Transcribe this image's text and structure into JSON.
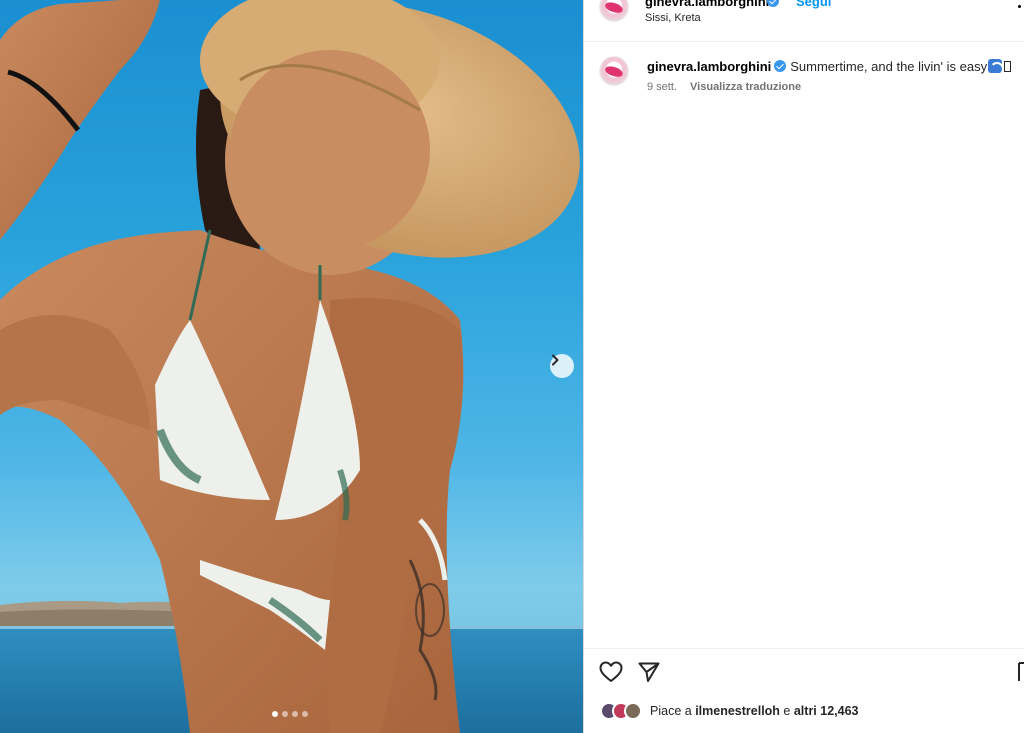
{
  "post": {
    "username": "ginevra.lamborghini",
    "follow_label": "Segui",
    "location": "Sissi, Kreta",
    "caption": "Summertime, and the livin' is easy",
    "date": "9 sett.",
    "translate_label": "Visualizza traduzione",
    "likes_prefix": "Piace a",
    "likes_user": "ilmenestrelloh",
    "likes_connector": "e",
    "likes_others": "altri 12,463"
  },
  "carousel": {
    "slides": 4,
    "active_index": 0
  },
  "icons": {
    "verified": "verified-badge-icon",
    "next": "chevron-right-icon",
    "like": "heart-icon",
    "share": "paper-plane-icon",
    "save": "bookmark-icon",
    "more": "more-options-icon",
    "caption_emoji": "wave-emoji-icon"
  },
  "colors": {
    "accent": "#0095f6",
    "verified": "#3897f0",
    "secondary_text": "#737373",
    "divider": "#dbdbdb"
  }
}
